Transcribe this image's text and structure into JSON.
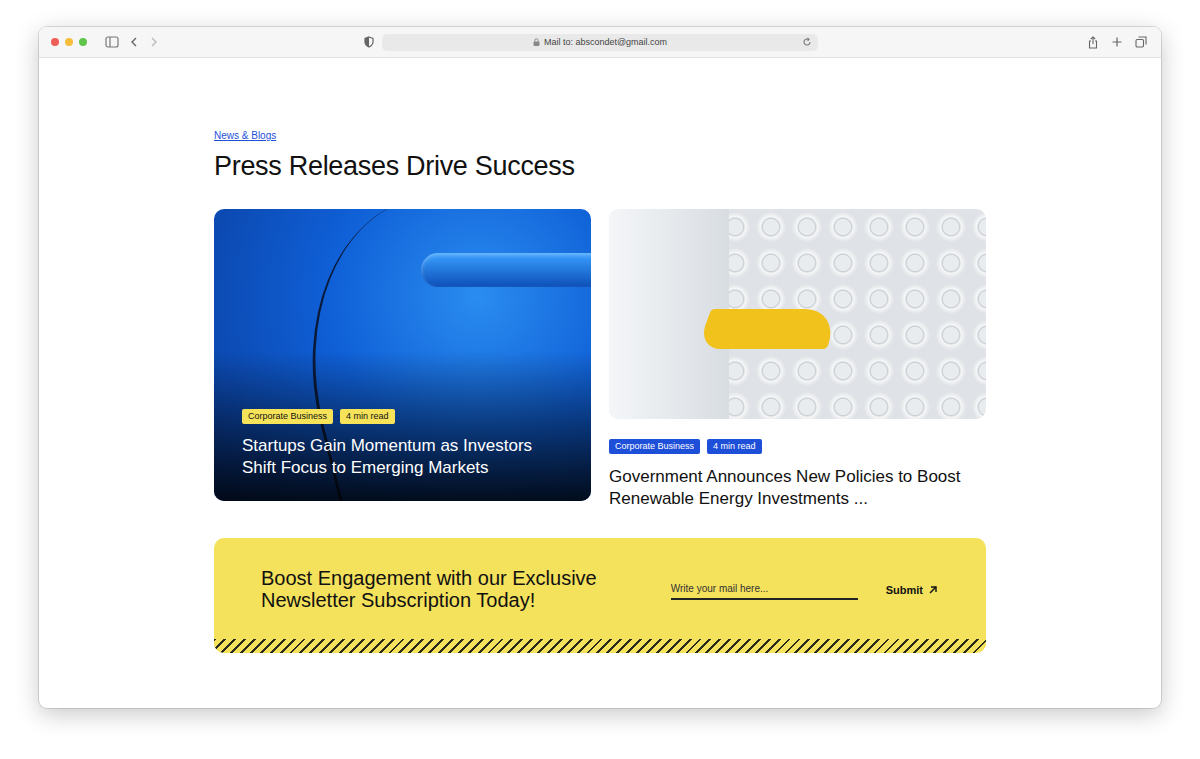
{
  "browser": {
    "address": "Mail to: abscondet@gmail.com"
  },
  "section": {
    "label": "News & Blogs",
    "title": "Press Releases Drive Success"
  },
  "articles": [
    {
      "kind": "overlay",
      "tags": [
        {
          "label": "Corporate Business",
          "color": "#f7e35a"
        },
        {
          "label": "4 min read",
          "color": "#f7e35a"
        }
      ],
      "title": "Startups Gain Momentum as Investors Shift Focus to Emerging Markets"
    },
    {
      "kind": "stacked",
      "tags": [
        {
          "label": "Corporate Business",
          "color": "#1d4fd8"
        },
        {
          "label": "4 min read",
          "color": "#1d4fd8"
        }
      ],
      "title": "Government Announces New Policies to Boost Renewable Energy Investments ..."
    }
  ],
  "newsletter": {
    "heading": "Boost Engagement with our Exclusive Newsletter Subscription Today!",
    "placeholder": "Write your mail here...",
    "button": "Submit"
  }
}
